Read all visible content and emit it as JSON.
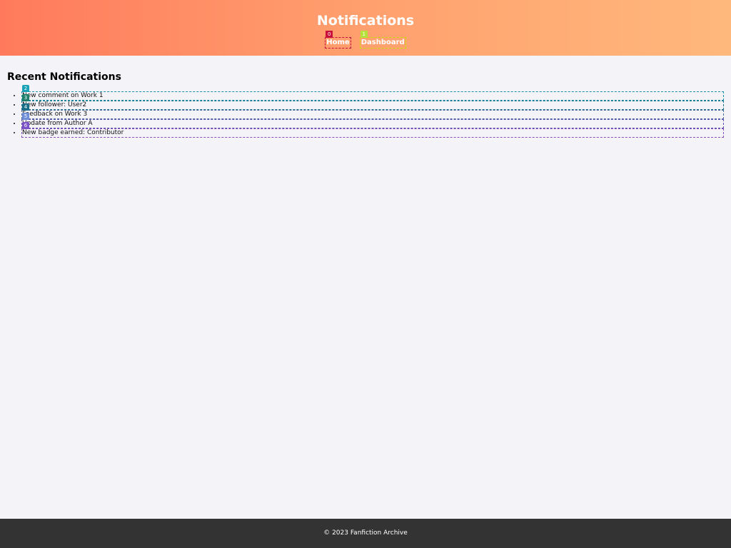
{
  "header": {
    "title": "Notifications",
    "nav": [
      {
        "label": "Home",
        "tag": "0"
      },
      {
        "label": "Dashboard",
        "tag": "1"
      }
    ]
  },
  "main": {
    "section_title": "Recent Notifications",
    "notifications": [
      {
        "text": "New comment on Work 1",
        "tag": "2"
      },
      {
        "text": "New follower: User2",
        "tag": "3"
      },
      {
        "text": "Feedback on Work 3",
        "tag": "4"
      },
      {
        "text": "Update from Author A",
        "tag": "5"
      },
      {
        "text": "New badge earned: Contributor",
        "tag": "6"
      }
    ]
  },
  "footer": {
    "text": "© 2023 Fanfiction Archive"
  },
  "colors": {
    "header_gradient_start": "#ff7a5c",
    "header_gradient_end": "#ffb87c",
    "footer_bg": "#333333",
    "page_bg": "#f4f4f8"
  }
}
